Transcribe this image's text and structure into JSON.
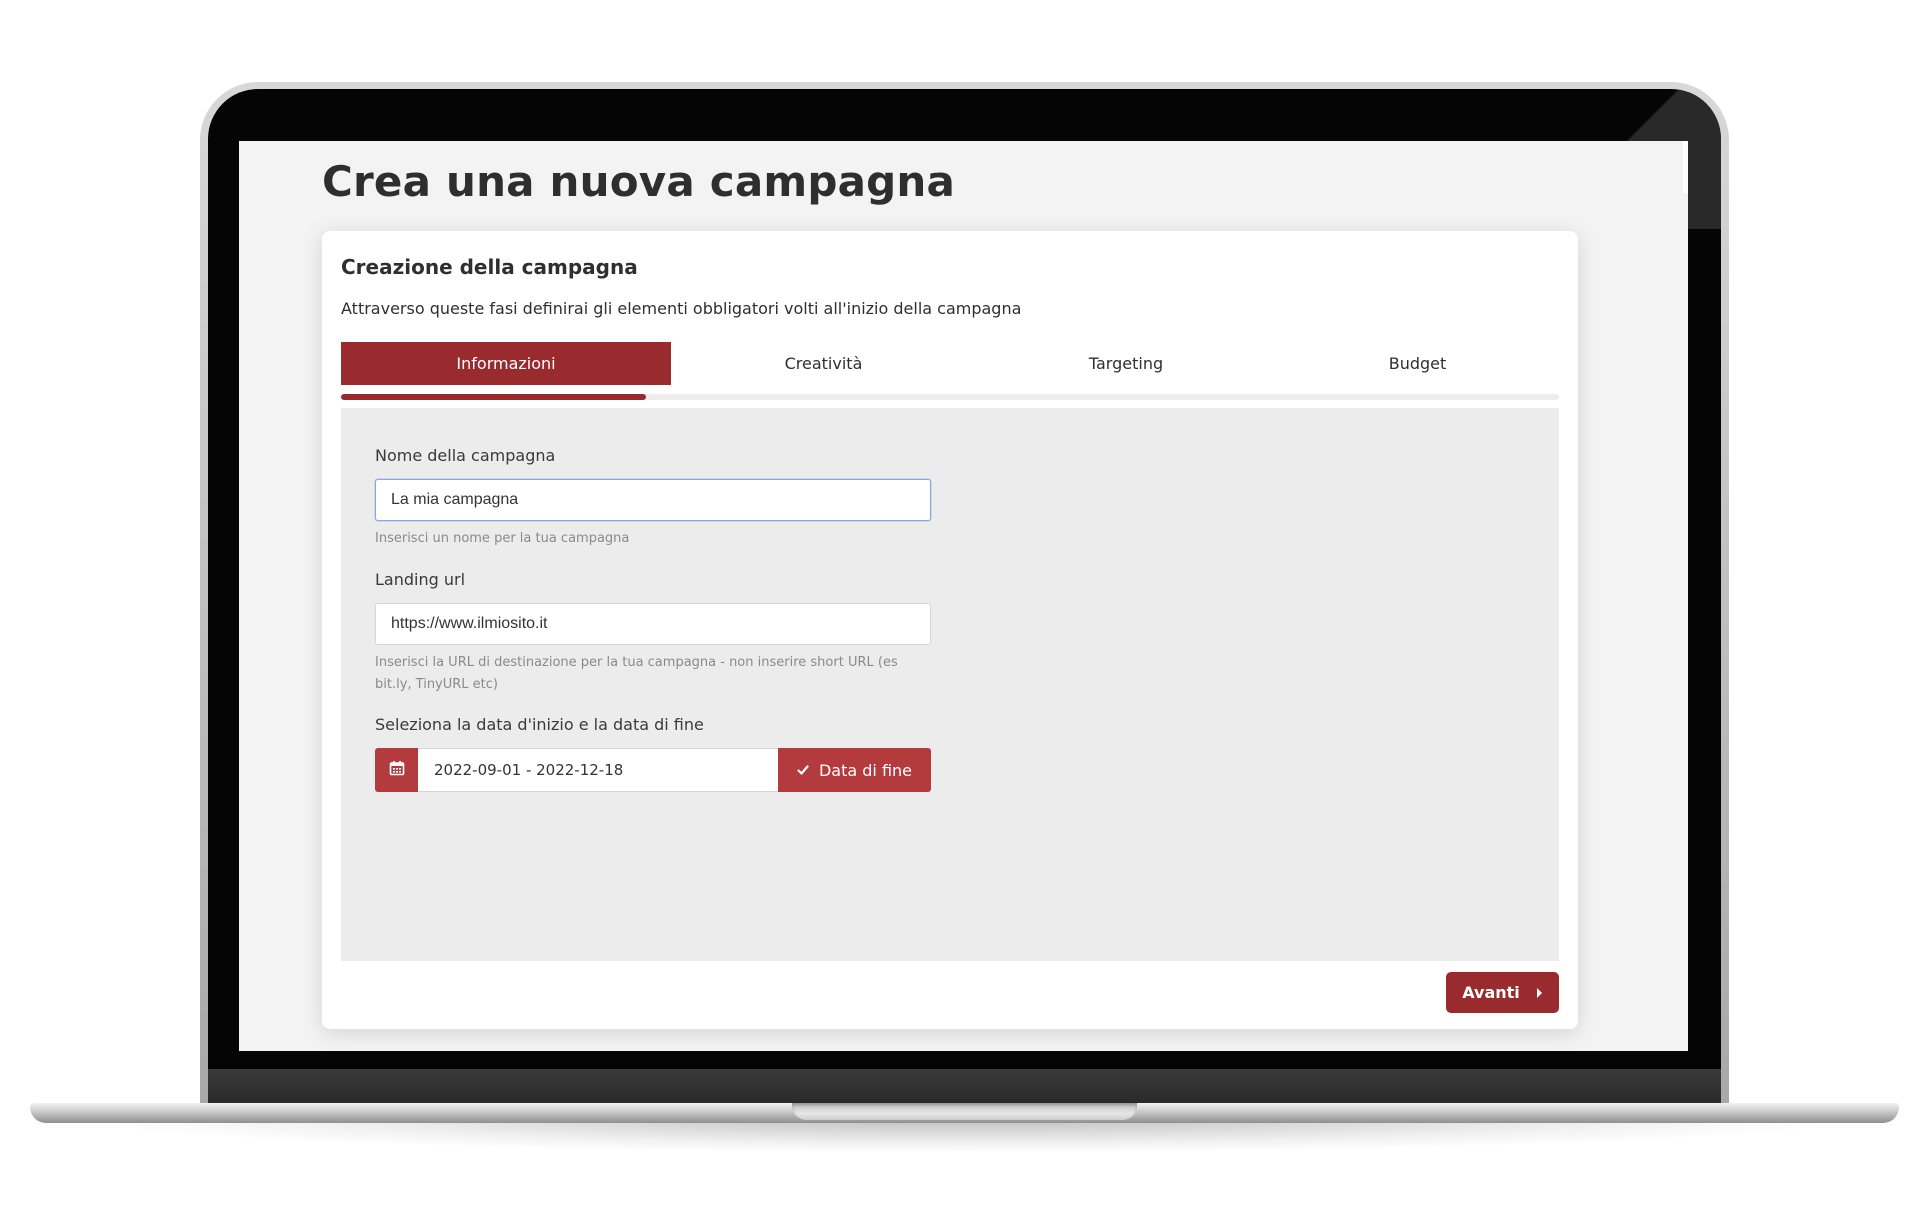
{
  "page": {
    "title": "Crea una nuova campagna"
  },
  "card": {
    "title": "Creazione della campagna",
    "description": "Attraverso queste fasi definirai gli elementi obbligatori volti all'inizio della campagna"
  },
  "steps": [
    {
      "label": "Informazioni",
      "active": true
    },
    {
      "label": "Creatività",
      "active": false
    },
    {
      "label": "Targeting",
      "active": false
    },
    {
      "label": "Budget",
      "active": false
    }
  ],
  "progress": {
    "fraction": 0.25
  },
  "form": {
    "campaign_name": {
      "label": "Nome della campagna",
      "value": "La mia campagna",
      "help": "Inserisci un nome per la tua campagna"
    },
    "landing_url": {
      "label": "Landing url",
      "value": "https://www.ilmiosito.it",
      "help": "Inserisci la URL di destinazione per la tua campagna - non inserire short URL (es bit.ly, TinyURL etc)"
    },
    "date_range": {
      "label": "Seleziona la data d'inizio e la data di fine",
      "value": "2022-09-01 - 2022-12-18",
      "end_button_label": "Data di fine"
    }
  },
  "footer": {
    "next_label": "Avanti"
  },
  "icons": {
    "calendar": "calendar-icon",
    "check": "check-icon",
    "caret_right": "caret-right-icon"
  },
  "colors": {
    "primary": "#992a2d",
    "accent_red": "#b33a3d",
    "panel_background": "#ececec",
    "page_background": "#f3f3f3"
  }
}
